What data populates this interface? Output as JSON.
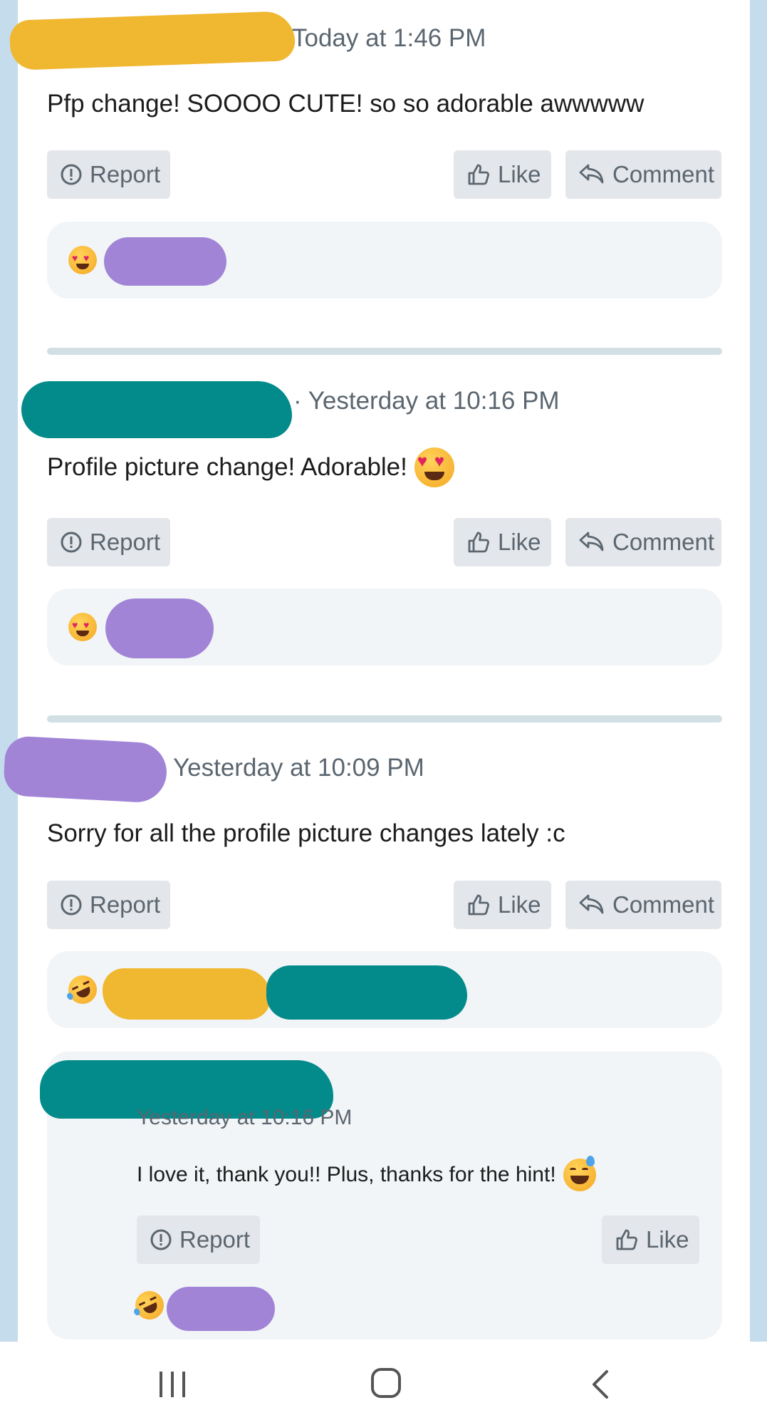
{
  "posts": [
    {
      "timestamp": "Today at 1:46 PM",
      "text": "Pfp change! SOOOO CUTE! so so adorable awwwww",
      "actions": {
        "report": "Report",
        "like": "Like",
        "comment": "Comment"
      },
      "reaction_emoji": "heart-eyes"
    },
    {
      "timestamp": "· Yesterday at 10:16 PM",
      "text": "Profile picture change! Adorable!",
      "text_emoji": "heart-eyes",
      "actions": {
        "report": "Report",
        "like": "Like",
        "comment": "Comment"
      },
      "reaction_emoji": "heart-eyes"
    },
    {
      "timestamp": "Yesterday at 10:09 PM",
      "text": "Sorry for all the profile picture changes lately :c",
      "actions": {
        "report": "Report",
        "like": "Like",
        "comment": "Comment"
      },
      "reaction_emoji": "rolling-laughing",
      "reply": {
        "timestamp": "Yesterday at 10:16 PM",
        "text": "I love it, thank you!! Plus, thanks for the hint!",
        "text_emoji": "sweat-smile",
        "actions": {
          "report": "Report",
          "like": "Like"
        },
        "reaction_emoji": "rolling-laughing"
      }
    }
  ],
  "colors": {
    "background_side": "#c5dcec",
    "button_bg": "#e3e6ea",
    "reaction_bg": "#f1f5f7",
    "redact_yellow": "#f0b731",
    "redact_teal": "#038a8a",
    "redact_purple": "#a184d6"
  },
  "navbar": {
    "icons": [
      "recent-apps-icon",
      "home-icon",
      "back-icon"
    ]
  }
}
